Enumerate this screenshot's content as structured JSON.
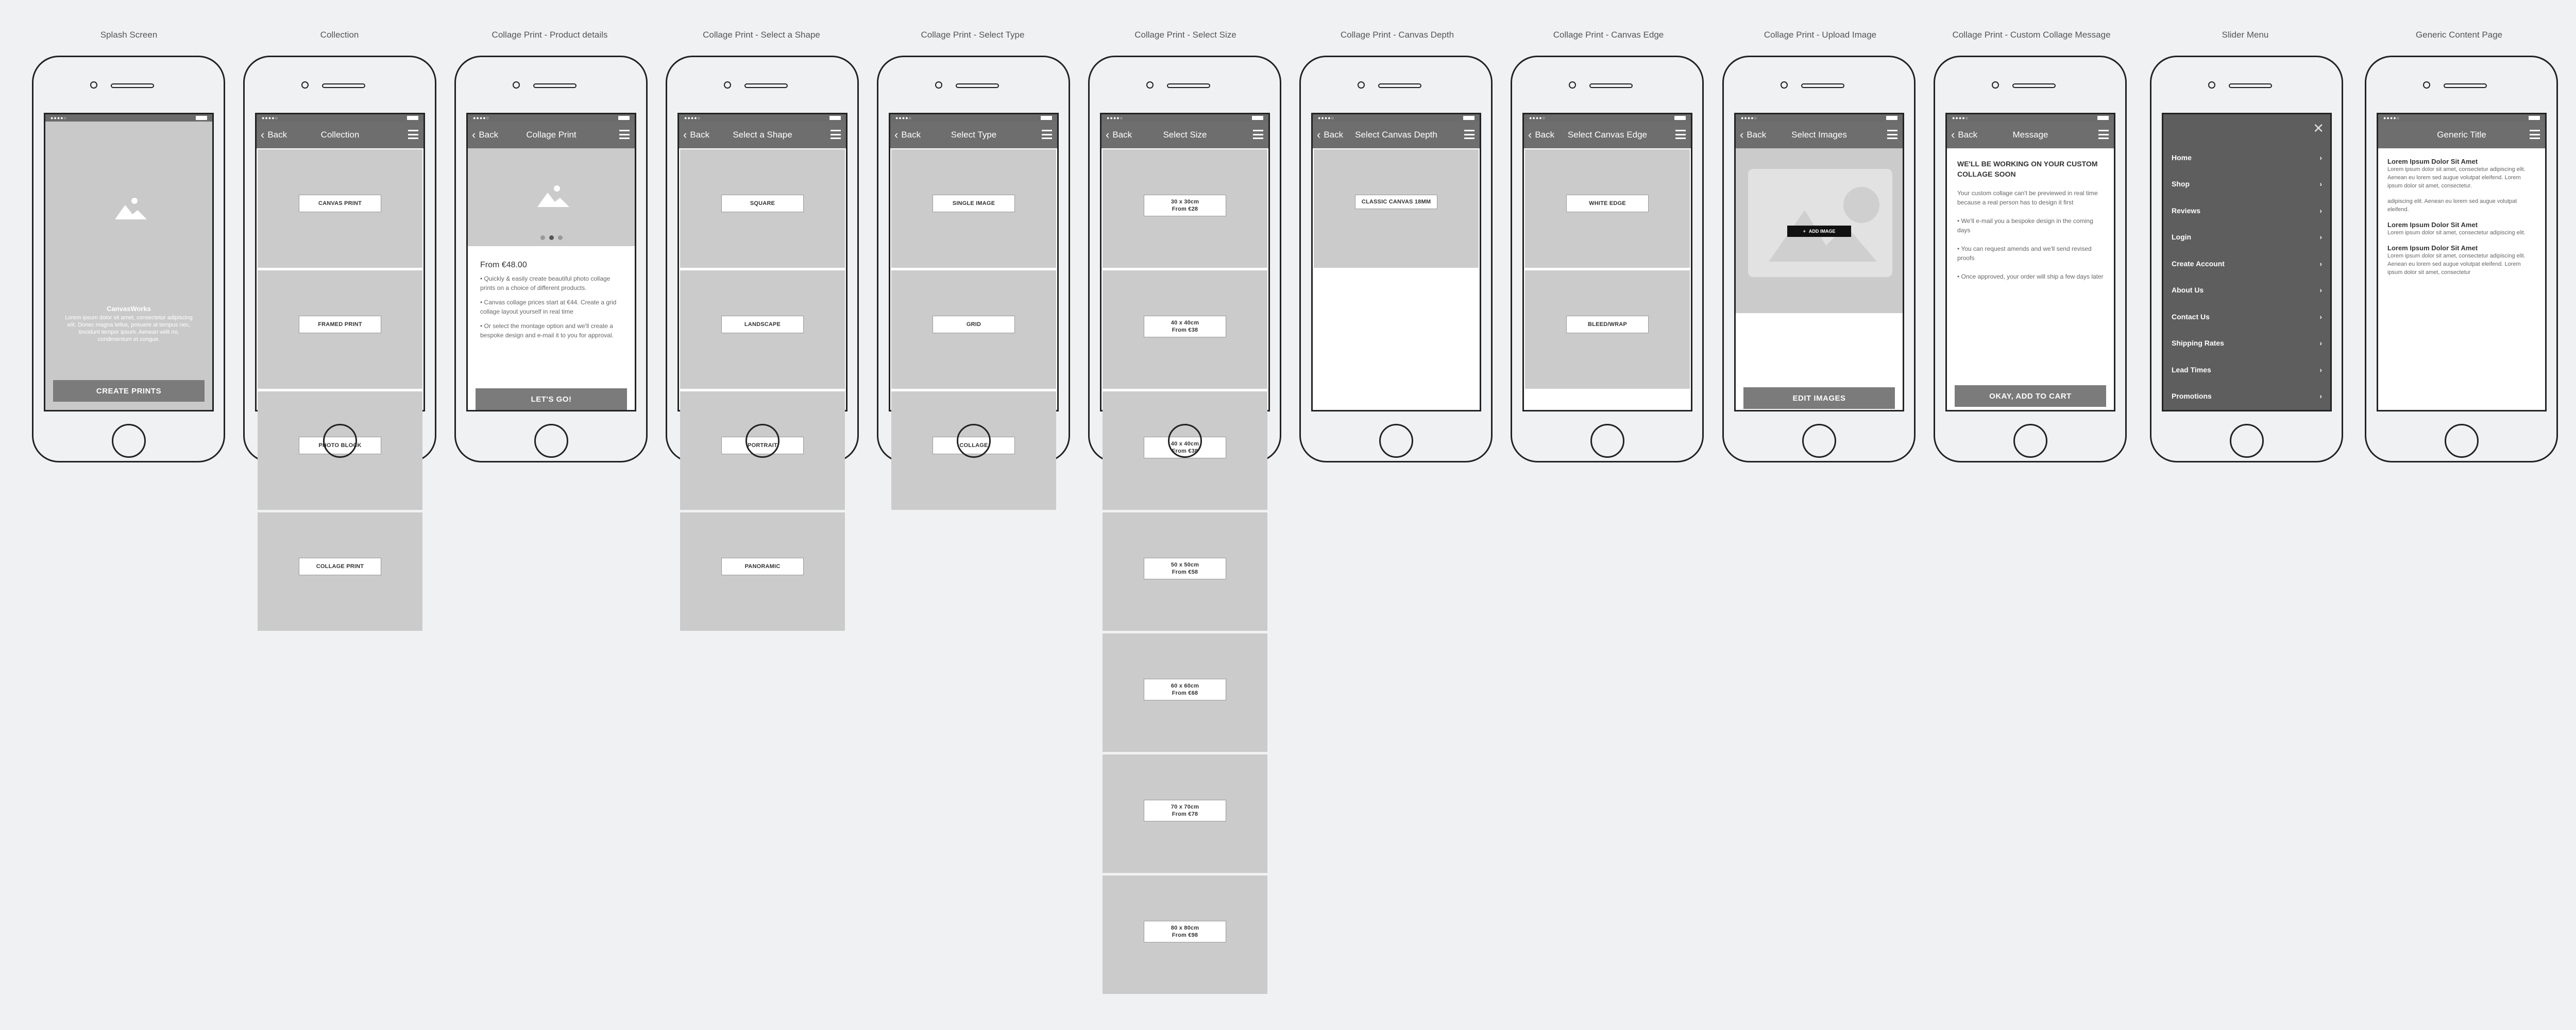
{
  "columns": [
    {
      "title": "Splash Screen"
    },
    {
      "title": "Collection"
    },
    {
      "title": "Collage Print - Product details"
    },
    {
      "title": "Collage Print - Select a Shape"
    },
    {
      "title": "Collage Print - Select Type"
    },
    {
      "title": "Collage Print - Select Size"
    },
    {
      "title": "Collage Print - Canvas Depth"
    },
    {
      "title": "Collage Print - Canvas Edge"
    },
    {
      "title": "Collage Print - Upload Image"
    },
    {
      "title": "Collage Print - Custom Collage Message"
    },
    {
      "title": "Slider Menu"
    },
    {
      "title": "Generic Content Page"
    }
  ],
  "status": {
    "signal": "●●●●○"
  },
  "nav": {
    "back": "Back"
  },
  "splash": {
    "brand": "CanvasWorks",
    "tagline": "Lorem ipsum dolor sit amet, consectetur adipiscing elit. Donec magna tellus, posuere at tempus nec, tincidunt tempor ipsum. Aenean velit mi, condimentum et congue.",
    "cta": "CREATE PRINTS"
  },
  "collection": {
    "title": "Collection",
    "items": [
      "CANVAS PRINT",
      "FRAMED PRINT",
      "PHOTO BLOCK",
      "COLLAGE PRINT"
    ]
  },
  "product": {
    "title": "Collage Print",
    "price": "From €48.00",
    "bullets": [
      "• Quickly & easily create beautiful photo collage prints on a choice of different products.",
      "• Canvas collage prices start at €44. Create a grid collage layout yourself in real time",
      "• Or select the montage option and we'll create a bespoke design and e-mail it to you for approval."
    ],
    "cta": "LET'S GO!"
  },
  "shape": {
    "title": "Select a Shape",
    "items": [
      "SQUARE",
      "LANDSCAPE",
      "PORTRAIT",
      "PANORAMIC"
    ]
  },
  "type": {
    "title": "Select Type",
    "items": [
      "SINGLE IMAGE",
      "GRID",
      "COLLAGE"
    ]
  },
  "size": {
    "title": "Select Size",
    "items": [
      {
        "dim": "30 x 30cm",
        "price": "From €28"
      },
      {
        "dim": "40 x 40cm",
        "price": "From €38"
      },
      {
        "dim": "40 x 40cm",
        "price": "From €38"
      },
      {
        "dim": "50 x 50cm",
        "price": "From €58"
      },
      {
        "dim": "60 x 60cm",
        "price": "From €68"
      },
      {
        "dim": "70 x 70cm",
        "price": "From €78"
      },
      {
        "dim": "80 x 80cm",
        "price": "From €98"
      }
    ]
  },
  "depth": {
    "title": "Select Canvas Depth",
    "items": [
      "CLASSIC CANVAS 18MM"
    ]
  },
  "edge": {
    "title": "Select Canvas Edge",
    "items": [
      "WHITE EDGE",
      "BLEED/WRAP"
    ]
  },
  "upload": {
    "title": "Select Images",
    "image_tag": "ADD IMAGE",
    "cta": "EDIT IMAGES"
  },
  "message": {
    "title": "Message",
    "heading": "WE'LL BE WORKING ON YOUR CUSTOM COLLAGE SOON",
    "paras": [
      "Your custom collage can't be previewed in real time because a real person has to design it first",
      "• We'll e-mail you a bespoke design in the coming days",
      "• You can request amends and we'll send revised proofs",
      "• Once approved, your order will ship a few days later"
    ],
    "cta": "OKAY, ADD TO CART"
  },
  "slider": {
    "items": [
      "Home",
      "Shop",
      "Reviews",
      "Login",
      "Create Account",
      "About Us",
      "Contact Us",
      "Shipping Rates",
      "Lead Times",
      "Promotions"
    ]
  },
  "generic": {
    "title": "Generic Title",
    "blocks": [
      {
        "heading": "Lorem Ipsum Dolor Sit Amet",
        "body": "Lorem ipsum dolor sit amet, consectetur adipiscing elit. Aenean eu lorem sed augue volutpat eleifend. Lorem ipsum dolor sit amet, consectetur."
      },
      {
        "heading": "",
        "body": "adipiscing elit. Aenean eu lorem sed augue volutpat eleifend."
      },
      {
        "heading": "Lorem Ipsum Dolor Sit Amet",
        "body": "Lorem ipsum dolor sit amet, consectetur adipiscing elit."
      },
      {
        "heading": "Lorem Ipsum Dolor Sit Amet",
        "body": "Lorem ipsum dolor sit amet, consectetur adipiscing elit. Aenean eu lorem sed augue volutpat eleifend. Lorem ipsum dolor sit amet, consectetur"
      }
    ]
  }
}
